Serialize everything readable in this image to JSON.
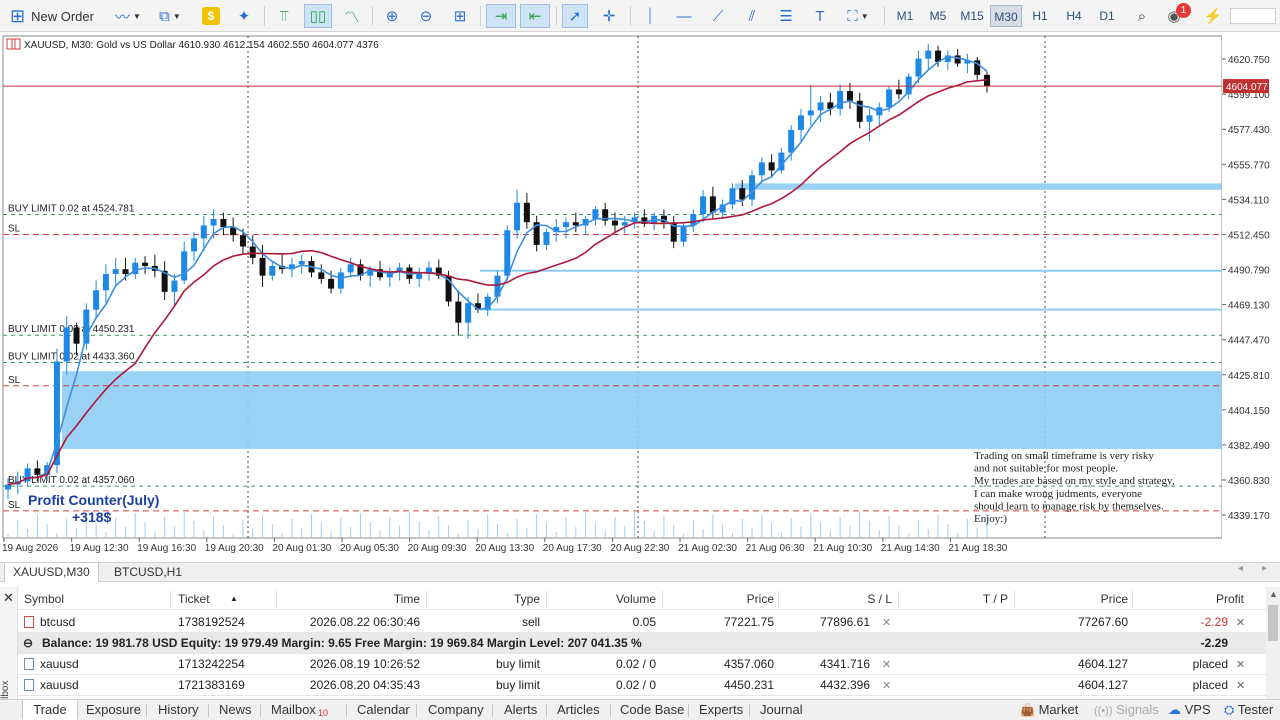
{
  "toolbar": {
    "new_order_label": "New Order",
    "timeframes": [
      "M1",
      "M5",
      "M15",
      "M30",
      "H1",
      "H4",
      "D1"
    ],
    "active_timeframe": "M30",
    "notification_count": "1"
  },
  "chart": {
    "header": "XAUUSD, M30:  Gold vs US Dollar  4610.930 4612.154 4602.550 4604.077  4376",
    "price_axis_labels": [
      "4620.750",
      "4599.100",
      "4577.430",
      "4555.770",
      "4534.110",
      "4512.450",
      "4490.790",
      "4469.130",
      "4447.470",
      "4425.810",
      "4404.150",
      "4382.490",
      "4360.830",
      "4339.170"
    ],
    "current_price": "4604.077",
    "time_axis_labels": [
      "19 Aug 2026",
      "19 Aug 12:30",
      "19 Aug 16:30",
      "19 Aug 20:30",
      "20 Aug 01:30",
      "20 Aug 05:30",
      "20 Aug 09:30",
      "20 Aug 13:30",
      "20 Aug 17:30",
      "20 Aug 22:30",
      "21 Aug 02:30",
      "21 Aug 06:30",
      "21 Aug 10:30",
      "21 Aug 14:30",
      "21 Aug 18:30"
    ],
    "order_labels": [
      {
        "text": "BUY LIMIT 0.02 at 4524.781",
        "price": 4524.781
      },
      {
        "text": "SL",
        "price": 4512.45
      },
      {
        "text": "BUY LIMIT 0.02 at 4450.231",
        "price": 4450.231
      },
      {
        "text": "BUY LIMIT 0.02 at 4433.360",
        "price": 4433.36
      },
      {
        "text": "SL",
        "price": 4419.0
      },
      {
        "text": "BUY LIMIT 0.02 at 4357.060",
        "price": 4357.06
      },
      {
        "text": "SL",
        "price": 4341.716
      }
    ],
    "profit_counter_title": "Profit Counter(July)",
    "profit_counter_value": "+318$",
    "disclaimer": [
      "Trading on small timeframe is very risky",
      "and not suitable for most people.",
      "My trades are based on my style and strategy,",
      "I can make wrong judments, everyone",
      "should learn to manage risk by themselves.",
      "Enjoy:)"
    ],
    "colors": {
      "bull": "#1e88e5",
      "bear": "#111111",
      "fast_ma": "#3b8ee0",
      "slow_ma": "#b0183a",
      "zone": "#8ecdf3",
      "price_line": "#c03030"
    }
  },
  "chart_tabs": [
    "XAUUSD,M30",
    "BTCUSD,H1"
  ],
  "trade": {
    "columns": [
      "Symbol",
      "Ticket",
      "Time",
      "Type",
      "Volume",
      "Price",
      "S / L",
      "T / P",
      "Price",
      "Profit"
    ],
    "rows": [
      {
        "symbol": "btcusd",
        "ticket": "1738192524",
        "time": "2026.08.22 06:30:46",
        "type": "sell",
        "volume": "0.05",
        "price": "77221.75",
        "sl": "77896.61",
        "tp": "",
        "cur_price": "77267.60",
        "profit": "-2.29"
      },
      {
        "symbol": "xauusd",
        "ticket": "1713242254",
        "time": "2026.08.19 10:26:52",
        "type": "buy limit",
        "volume": "0.02 / 0",
        "price": "4357.060",
        "sl": "4341.716",
        "tp": "",
        "cur_price": "4604.127",
        "profit": "placed"
      },
      {
        "symbol": "xauusd",
        "ticket": "1721383169",
        "time": "2026.08.20 04:35:43",
        "type": "buy limit",
        "volume": "0.02 / 0",
        "price": "4450.231",
        "sl": "4432.396",
        "tp": "",
        "cur_price": "4604.127",
        "profit": "placed"
      }
    ],
    "summary": "Balance: 19 981.78 USD  Equity: 19 979.49  Margin: 9.65  Free Margin: 19 969.84  Margin Level: 207 041.35 %",
    "summary_profit": "-2.29"
  },
  "bottom_tabs": [
    "Trade",
    "Exposure",
    "History",
    "News",
    "Mailbox",
    "Calendar",
    "Company",
    "Alerts",
    "Articles",
    "Code Base",
    "Experts",
    "Journal"
  ],
  "mailbox_count": "10",
  "active_bottom_tab": "Trade",
  "right_tabs": [
    "Market",
    "Signals",
    "VPS",
    "Tester"
  ],
  "toolbox_label": "Toolbox",
  "chart_data": {
    "type": "candlestick",
    "symbol": "XAUUSD",
    "timeframe": "M30",
    "ylim": [
      4325,
      4635
    ],
    "candles": [
      [
        4355,
        4362,
        4349,
        4358
      ],
      [
        4358,
        4366,
        4352,
        4360
      ],
      [
        4360,
        4371,
        4357,
        4368
      ],
      [
        4368,
        4373,
        4360,
        4364
      ],
      [
        4364,
        4372,
        4360,
        4370
      ],
      [
        4370,
        4442,
        4365,
        4434
      ],
      [
        4434,
        4462,
        4426,
        4455
      ],
      [
        4455,
        4458,
        4438,
        4445
      ],
      [
        4445,
        4470,
        4441,
        4466
      ],
      [
        4466,
        4484,
        4460,
        4478
      ],
      [
        4478,
        4494,
        4470,
        4488
      ],
      [
        4488,
        4498,
        4480,
        4491
      ],
      [
        4491,
        4498,
        4484,
        4488
      ],
      [
        4488,
        4498,
        4485,
        4495
      ],
      [
        4495,
        4499,
        4488,
        4493
      ],
      [
        4493,
        4500,
        4486,
        4490
      ],
      [
        4490,
        4496,
        4472,
        4477
      ],
      [
        4477,
        4488,
        4468,
        4484
      ],
      [
        4484,
        4508,
        4482,
        4502
      ],
      [
        4502,
        4514,
        4496,
        4510
      ],
      [
        4510,
        4524,
        4502,
        4518
      ],
      [
        4518,
        4528,
        4510,
        4522
      ],
      [
        4522,
        4526,
        4512,
        4517
      ],
      [
        4517,
        4523,
        4508,
        4512
      ],
      [
        4512,
        4516,
        4500,
        4505
      ],
      [
        4505,
        4512,
        4494,
        4498
      ],
      [
        4498,
        4506,
        4480,
        4487
      ],
      [
        4487,
        4496,
        4484,
        4493
      ],
      [
        4493,
        4500,
        4488,
        4491
      ],
      [
        4491,
        4498,
        4486,
        4494
      ],
      [
        4494,
        4500,
        4488,
        4496
      ],
      [
        4496,
        4499,
        4486,
        4489
      ],
      [
        4489,
        4494,
        4482,
        4485
      ],
      [
        4485,
        4490,
        4476,
        4479
      ],
      [
        4479,
        4492,
        4476,
        4489
      ],
      [
        4489,
        4498,
        4486,
        4494
      ],
      [
        4494,
        4497,
        4484,
        4487
      ],
      [
        4487,
        4493,
        4480,
        4491
      ],
      [
        4491,
        4496,
        4484,
        4486
      ],
      [
        4486,
        4492,
        4480,
        4489
      ],
      [
        4489,
        4495,
        4484,
        4492
      ],
      [
        4492,
        4494,
        4482,
        4485
      ],
      [
        4485,
        4492,
        4480,
        4488
      ],
      [
        4488,
        4496,
        4484,
        4492
      ],
      [
        4492,
        4497,
        4485,
        4487
      ],
      [
        4487,
        4490,
        4468,
        4471
      ],
      [
        4471,
        4478,
        4450,
        4458
      ],
      [
        4458,
        4474,
        4448,
        4470
      ],
      [
        4470,
        4476,
        4464,
        4466
      ],
      [
        4466,
        4476,
        4462,
        4474
      ],
      [
        4474,
        4490,
        4470,
        4487
      ],
      [
        4487,
        4518,
        4484,
        4515
      ],
      [
        4515,
        4540,
        4510,
        4532
      ],
      [
        4532,
        4538,
        4516,
        4520
      ],
      [
        4520,
        4524,
        4502,
        4506
      ],
      [
        4506,
        4516,
        4503,
        4514
      ],
      [
        4514,
        4522,
        4508,
        4517
      ],
      [
        4517,
        4523,
        4510,
        4520
      ],
      [
        4520,
        4526,
        4514,
        4518
      ],
      [
        4518,
        4524,
        4512,
        4522
      ],
      [
        4522,
        4530,
        4518,
        4528
      ],
      [
        4528,
        4532,
        4518,
        4521
      ],
      [
        4521,
        4526,
        4514,
        4518
      ],
      [
        4518,
        4524,
        4513,
        4520
      ],
      [
        4520,
        4526,
        4516,
        4523
      ],
      [
        4523,
        4528,
        4517,
        4519
      ],
      [
        4519,
        4526,
        4515,
        4524
      ],
      [
        4524,
        4528,
        4516,
        4520
      ],
      [
        4520,
        4524,
        4504,
        4508
      ],
      [
        4508,
        4520,
        4505,
        4518
      ],
      [
        4518,
        4528,
        4514,
        4525
      ],
      [
        4525,
        4540,
        4520,
        4536
      ],
      [
        4536,
        4542,
        4522,
        4526
      ],
      [
        4526,
        4534,
        4522,
        4531
      ],
      [
        4531,
        4544,
        4528,
        4541
      ],
      [
        4541,
        4546,
        4530,
        4534
      ],
      [
        4534,
        4552,
        4530,
        4549
      ],
      [
        4549,
        4560,
        4544,
        4557
      ],
      [
        4557,
        4562,
        4548,
        4552
      ],
      [
        4552,
        4566,
        4550,
        4563
      ],
      [
        4563,
        4580,
        4558,
        4577
      ],
      [
        4577,
        4590,
        4570,
        4586
      ],
      [
        4586,
        4605,
        4580,
        4589
      ],
      [
        4589,
        4598,
        4582,
        4594
      ],
      [
        4594,
        4600,
        4586,
        4590
      ],
      [
        4590,
        4605,
        4586,
        4601
      ],
      [
        4601,
        4606,
        4590,
        4595
      ],
      [
        4595,
        4600,
        4578,
        4582
      ],
      [
        4582,
        4590,
        4570,
        4586
      ],
      [
        4586,
        4594,
        4580,
        4591
      ],
      [
        4591,
        4604,
        4588,
        4602
      ],
      [
        4602,
        4608,
        4596,
        4599
      ],
      [
        4599,
        4612,
        4596,
        4610
      ],
      [
        4610,
        4626,
        4606,
        4621
      ],
      [
        4621,
        4630,
        4614,
        4626
      ],
      [
        4626,
        4629,
        4616,
        4619
      ],
      [
        4619,
        4626,
        4614,
        4623
      ],
      [
        4623,
        4627,
        4616,
        4618
      ],
      [
        4618,
        4624,
        4612,
        4620
      ],
      [
        4620,
        4622,
        4608,
        4611
      ],
      [
        4611,
        4613,
        4600,
        4604
      ]
    ],
    "indicators": [
      "fast moving average (blue)",
      "slow moving average (red)"
    ],
    "zones": [
      [
        4380,
        4428
      ],
      [
        4540,
        4544
      ]
    ]
  }
}
